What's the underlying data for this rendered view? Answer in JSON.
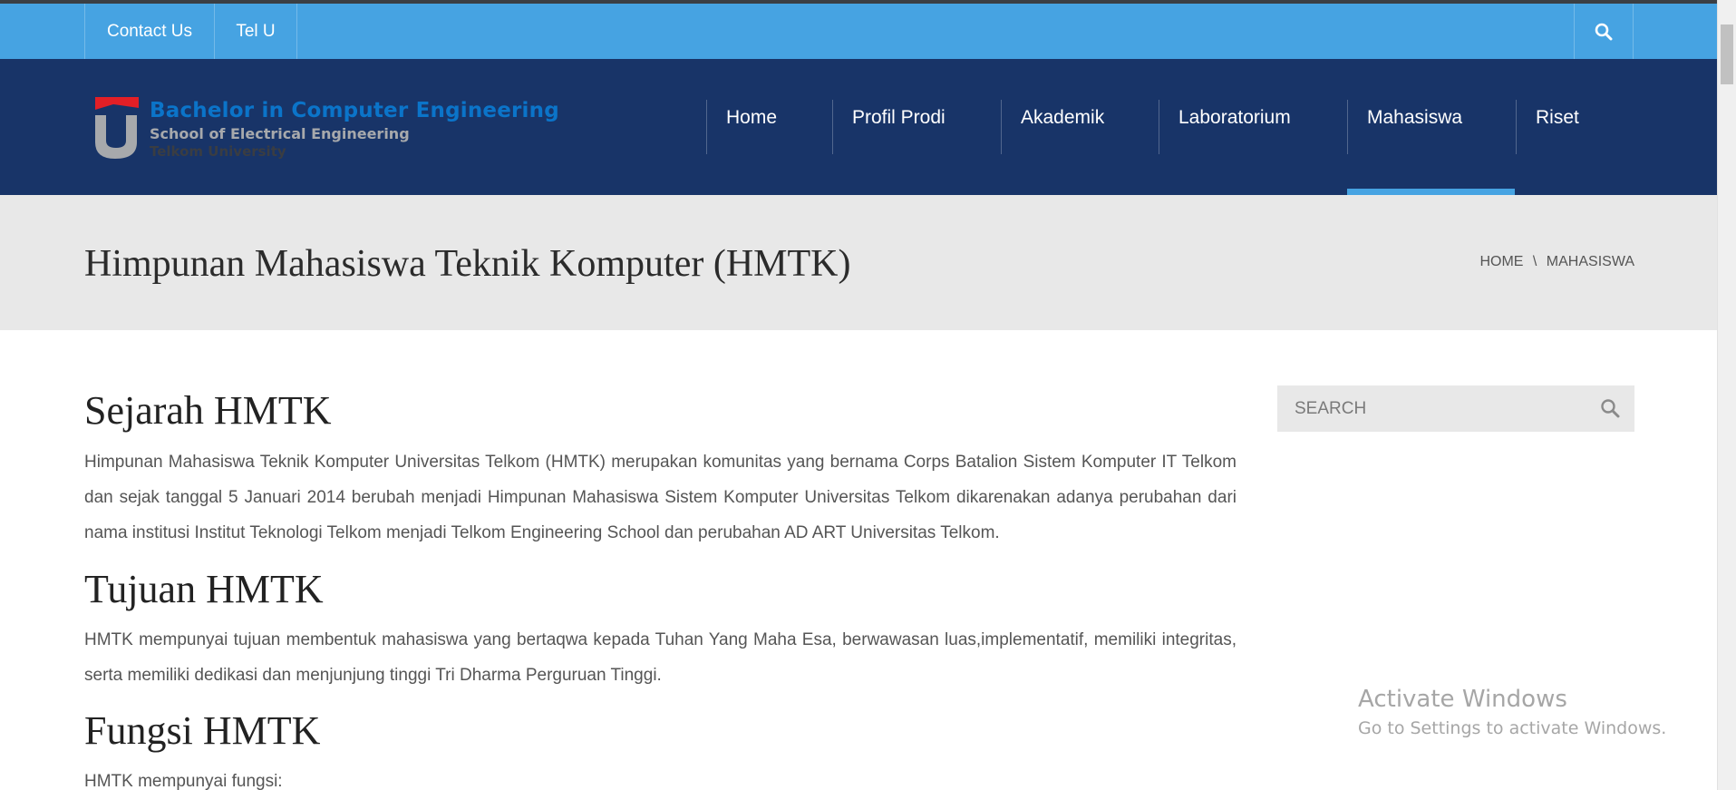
{
  "topbar": {
    "links": [
      {
        "label": "Contact Us"
      },
      {
        "label": "Tel U"
      }
    ],
    "search_icon": "search-icon"
  },
  "logo": {
    "line1": "Bachelor in Computer Engineering",
    "line2": "School of Electrical Engineering",
    "line3": "Telkom University"
  },
  "nav": {
    "items": [
      {
        "label": "Home"
      },
      {
        "label": "Profil Prodi"
      },
      {
        "label": "Akademik"
      },
      {
        "label": "Laboratorium"
      },
      {
        "label": "Mahasiswa",
        "active": true
      },
      {
        "label": "Riset"
      }
    ]
  },
  "title_band": {
    "title": "Himpunan Mahasiswa Teknik Komputer (HMTK)",
    "breadcrumb": [
      "HOME",
      "MAHASISWA"
    ],
    "breadcrumb_separator": "\\"
  },
  "content": {
    "sejarah_heading": "Sejarah HMTK",
    "sejarah_text": "Himpunan Mahasiswa Teknik Komputer Universitas Telkom (HMTK) merupakan komunitas yang bernama Corps Batalion Sistem Komputer IT Telkom dan sejak tanggal 5 Januari 2014 berubah menjadi Himpunan Mahasiswa Sistem Komputer Universitas Telkom dikarenakan adanya perubahan dari nama institusi Institut Teknologi Telkom menjadi Telkom Engineering School dan perubahan AD ART Universitas Telkom.",
    "tujuan_heading": "Tujuan HMTK",
    "tujuan_text": "HMTK mempunyai tujuan membentuk mahasiswa yang bertaqwa kepada Tuhan Yang Maha Esa, berwawasan luas,implementatif, memiliki integritas, serta memiliki dedikasi dan menjunjung tinggi Tri Dharma Perguruan Tinggi.",
    "fungsi_heading": "Fungsi HMTK",
    "fungsi_text": "HMTK mempunyai fungsi:"
  },
  "sidebar": {
    "search_placeholder": "SEARCH"
  },
  "watermark": {
    "line1": "Activate Windows",
    "line2": "Go to Settings to activate Windows."
  },
  "colors": {
    "topbar": "#46a3e2",
    "navbar": "#183468",
    "title_band": "#e8e8e8",
    "active_indicator": "#46a3e2"
  }
}
